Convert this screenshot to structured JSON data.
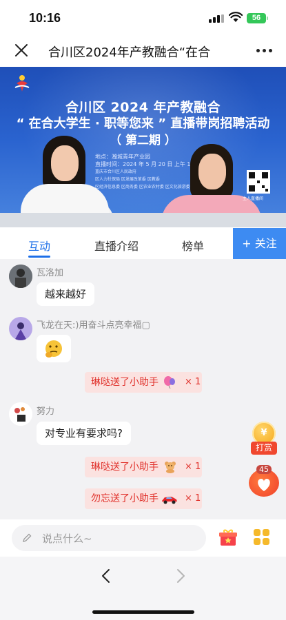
{
  "status": {
    "time": "10:16",
    "battery": "56"
  },
  "navbar": {
    "title": "合川区2024年产教融合“在合"
  },
  "video": {
    "title_line1": "合川区 2024 年产教融合",
    "title_line2": "“ 在合大学生 · 职等您来 ” 直播带岗招聘活动",
    "title_line3": "（ 第二期 ）",
    "place": "地点：瀚城青年产业园",
    "time": "直播时间：2024 年 5 月 20 日  上午 10",
    "org1": "重庆市合川区人民政府",
    "org2": "区人力社保局 区发展改革委 区教委",
    "org3": "区经济信息委 区商务委 区农业农村委 区文化旅游委",
    "qr_label": "主人直播间"
  },
  "tabs": [
    {
      "label": "互动",
      "active": true
    },
    {
      "label": "直播介绍",
      "active": false
    },
    {
      "label": "榜单",
      "active": false
    }
  ],
  "follow_label": "+ 关注",
  "chat": {
    "msg1": {
      "user": "瓦洛加",
      "text": "越来越好"
    },
    "msg2": {
      "user": "飞龙在天:)用奋斗点亮幸福▢"
    },
    "gift1": {
      "text": "琳哒送了小助手",
      "count": "× 1",
      "icon": "balloon-icon"
    },
    "msg3": {
      "user": "努力",
      "text": "对专业有要求吗?"
    },
    "gift2": {
      "text": "琳哒送了小助手",
      "count": "× 1",
      "icon": "teddy-bear-icon"
    },
    "gift3": {
      "text": "勿忘送了小助手",
      "count": "× 1",
      "icon": "sports-car-icon"
    }
  },
  "reward": {
    "coin": "¥",
    "label": "打赏"
  },
  "likes": {
    "count": "45"
  },
  "input": {
    "placeholder": "说点什么~"
  },
  "colors": {
    "accent": "#1d6fe8",
    "follow_bg": "#3d8bf2",
    "gift_bg": "#fbe2e0",
    "gift_text": "#e0302a"
  }
}
